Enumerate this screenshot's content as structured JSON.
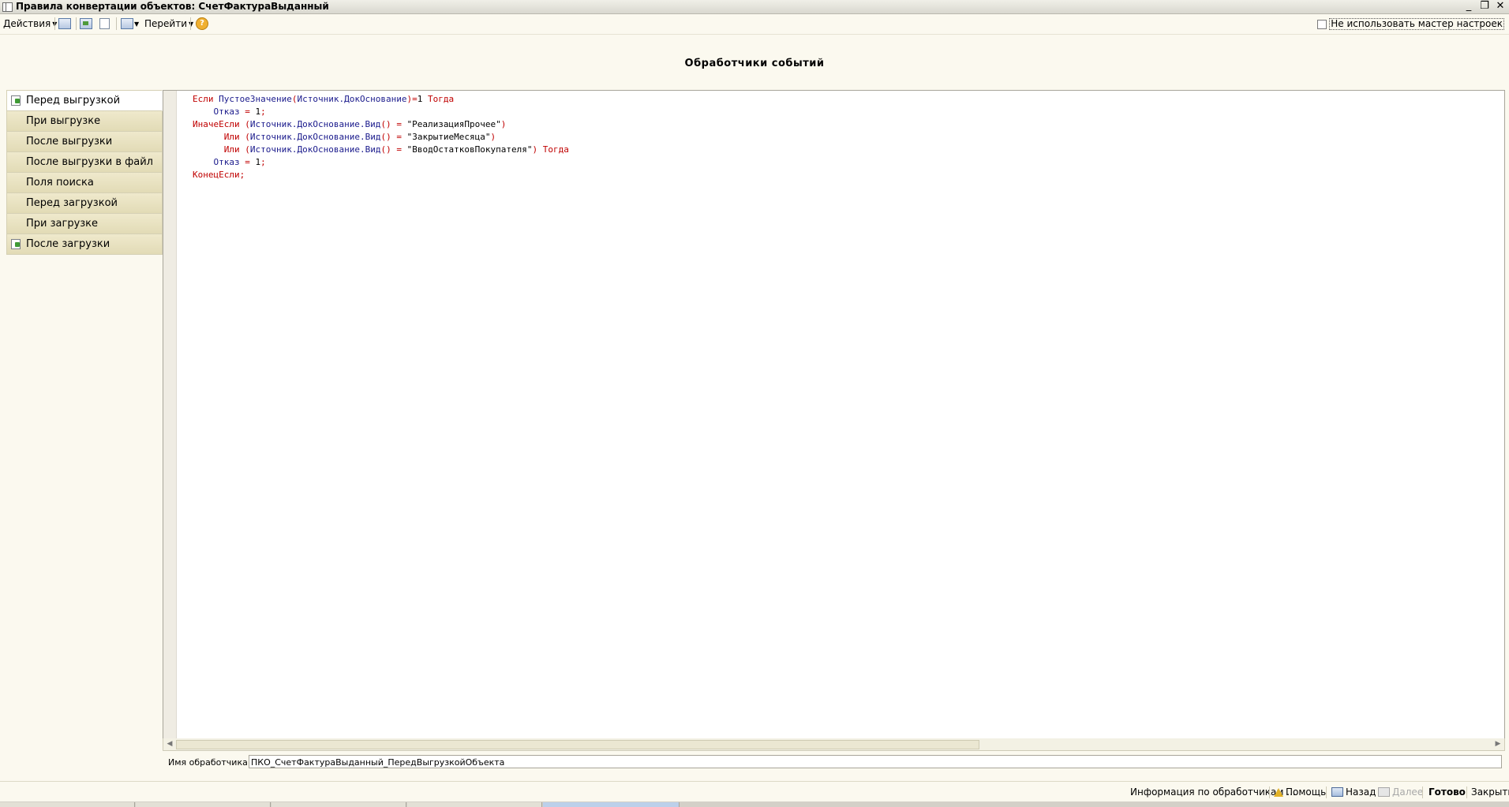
{
  "window": {
    "title": "Правила конвертации объектов: СчетФактураВыданный"
  },
  "toolbar": {
    "actions_label": "Действия",
    "goto_label": "Перейти",
    "help_icon_label": "?",
    "checkbox_label": "Не использовать мастер настроек"
  },
  "heading": "Обработчики событий",
  "tabs": [
    {
      "label": "Перед выгрузкой",
      "active": true,
      "has_handler": true
    },
    {
      "label": "При выгрузке",
      "active": false,
      "has_handler": false
    },
    {
      "label": "После выгрузки",
      "active": false,
      "has_handler": false
    },
    {
      "label": "После выгрузки в файл",
      "active": false,
      "has_handler": false
    },
    {
      "label": "Поля поиска",
      "active": false,
      "has_handler": false
    },
    {
      "label": "Перед загрузкой",
      "active": false,
      "has_handler": false
    },
    {
      "label": "При загрузке",
      "active": false,
      "has_handler": false
    },
    {
      "label": "После загрузки",
      "active": false,
      "has_handler": true
    }
  ],
  "code_lines": [
    "Если ПустоеЗначение(Источник.ДокОснование)=1 Тогда",
    "    Отказ = 1;",
    "ИначеЕсли (Источник.ДокОснование.Вид() = \"РеализацияПрочее\")",
    "      Или (Источник.ДокОснование.Вид() = \"ЗакрытиеМесяца\")",
    "      Или (Источник.ДокОснование.Вид() = \"ВводОстатковПокупателя\") Тогда",
    "    Отказ = 1;",
    "КонецЕсли;"
  ],
  "handler": {
    "label": "Имя обработчика:",
    "value": "ПКО_СчетФактураВыданный_ПередВыгрузкойОбъекта"
  },
  "bottom": {
    "info_label": "Информация по обработчикам ...",
    "help_label": "Помощь",
    "back_label": "Назад",
    "next_label": "Далее",
    "done_label": "Готово",
    "close_label": "Закрыть"
  }
}
